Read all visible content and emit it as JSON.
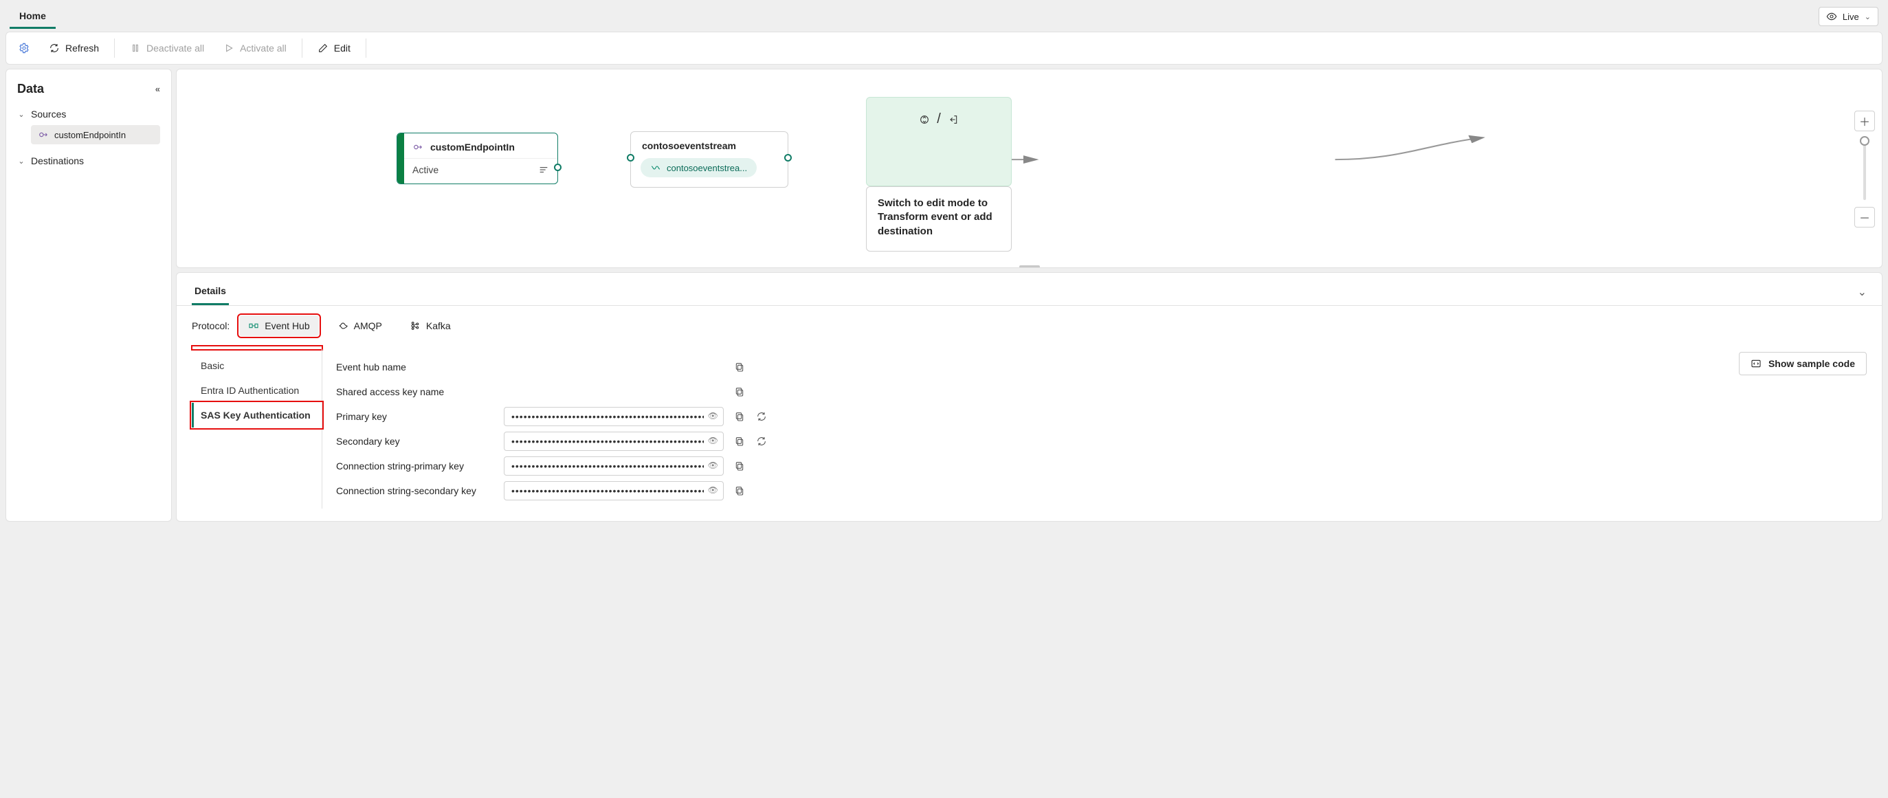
{
  "tabs": {
    "home": "Home"
  },
  "live": {
    "label": "Live"
  },
  "toolbar": {
    "refresh": "Refresh",
    "deactivate": "Deactivate all",
    "activate": "Activate all",
    "edit": "Edit"
  },
  "side": {
    "title": "Data",
    "sources": "Sources",
    "destinations": "Destinations",
    "endpoint": "customEndpointIn"
  },
  "nodes": {
    "src": {
      "title": "customEndpointIn",
      "status": "Active"
    },
    "stream": {
      "title": "contosoeventstream",
      "chip": "contosoeventstrea..."
    },
    "dest_msg": "Switch to edit mode to Transform event or add destination"
  },
  "details": {
    "tab": "Details",
    "protocol_label": "Protocol:",
    "protocols": {
      "eventhub": "Event Hub",
      "amqp": "AMQP",
      "kafka": "Kafka"
    },
    "side_tabs": {
      "basic": "Basic",
      "entra": "Entra ID Authentication",
      "sas": "SAS Key Authentication"
    },
    "fields": {
      "hubname": "Event hub name",
      "sakname": "Shared access key name",
      "pkey": "Primary key",
      "skey": "Secondary key",
      "cs_pkey": "Connection string-primary key",
      "cs_skey": "Connection string-secondary key"
    },
    "sample_btn": "Show sample code",
    "mask": "••••••••••••••••••••••••••••••••••••••••••••••••••••••"
  }
}
